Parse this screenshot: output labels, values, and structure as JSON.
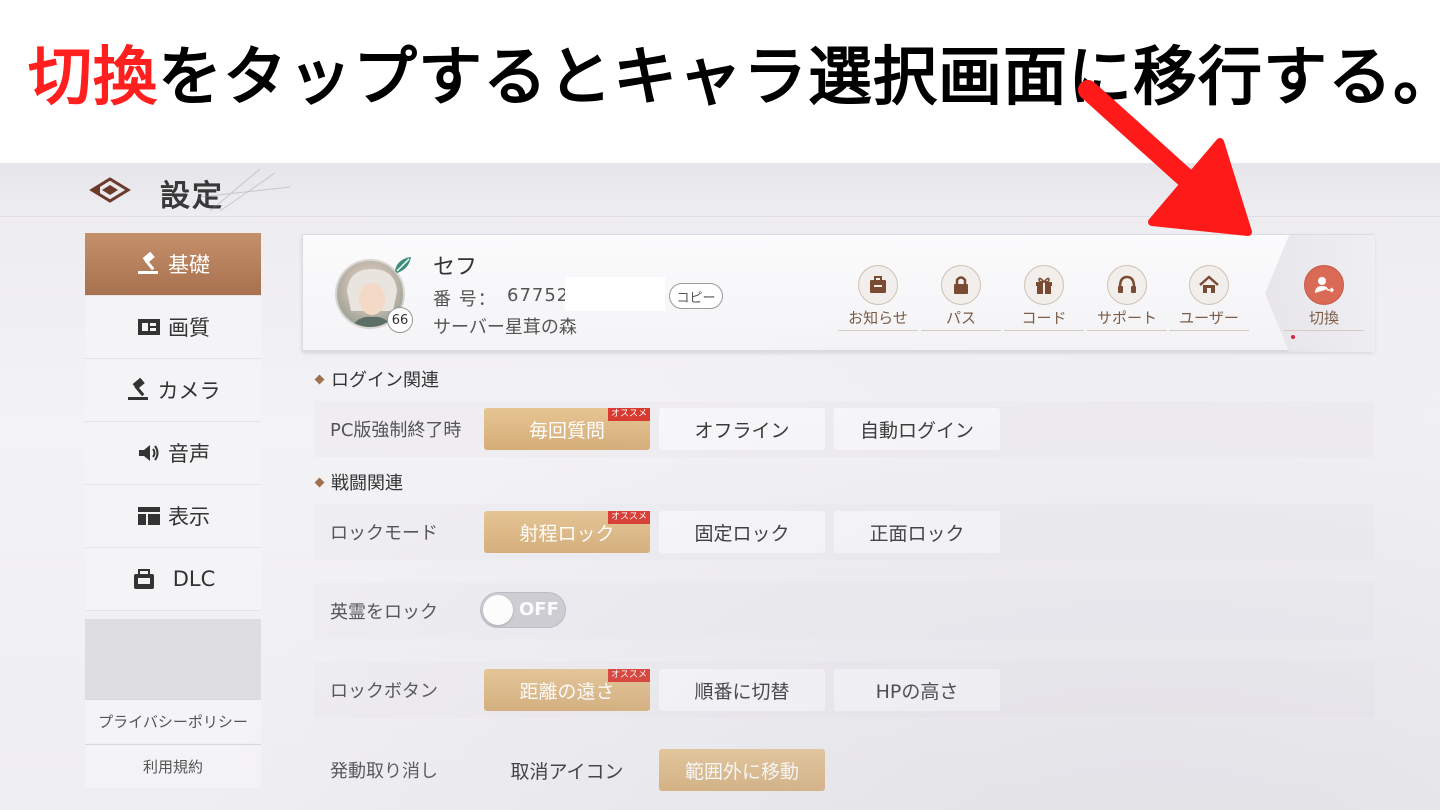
{
  "caption": {
    "highlight": "切換",
    "rest": "をタップするとキャラ選択画面に移行する。"
  },
  "header": {
    "title": "設定"
  },
  "sidebar": {
    "items": [
      {
        "label": "基礎",
        "icon": "hammer-icon",
        "active": true
      },
      {
        "label": "画質",
        "icon": "display-quality-icon",
        "active": false
      },
      {
        "label": "カメラ",
        "icon": "camera-icon",
        "active": false
      },
      {
        "label": "音声",
        "icon": "speaker-icon",
        "active": false
      },
      {
        "label": "表示",
        "icon": "layout-icon",
        "active": false
      },
      {
        "label": "DLC",
        "icon": "bag-icon",
        "active": false
      }
    ],
    "privacy": "プライバシーポリシー",
    "terms": "利用規約"
  },
  "profile": {
    "name": "セフ",
    "id_label": "番 号：",
    "id": "67752",
    "copy": "コピー",
    "server": "サーバー星茸の森",
    "level": "66"
  },
  "quick_actions": [
    {
      "label": "お知らせ",
      "icon": "notice-icon"
    },
    {
      "label": "パス",
      "icon": "lock-icon"
    },
    {
      "label": "コード",
      "icon": "gift-icon"
    },
    {
      "label": "サポート",
      "icon": "headset-icon"
    },
    {
      "label": "ユーザー",
      "icon": "home-icon"
    }
  ],
  "switch_action": {
    "label": "切換",
    "icon": "switch-user-icon"
  },
  "sections": {
    "login": "ログイン関連",
    "battle": "戦闘関連"
  },
  "settings": {
    "pc_exit": {
      "label": "PC版強制終了時",
      "options": [
        "毎回質問",
        "オフライン",
        "自動ログイン"
      ],
      "selected": 0,
      "recommended": 0
    },
    "lock_mode": {
      "label": "ロックモード",
      "options": [
        "射程ロック",
        "固定ロック",
        "正面ロック"
      ],
      "selected": 0,
      "recommended": 0
    },
    "hero_lock": {
      "label": "英霊をロック",
      "state": "OFF"
    },
    "lock_button": {
      "label": "ロックボタン",
      "options": [
        "距離の遠さ",
        "順番に切替",
        "HPの高さ"
      ],
      "selected": 0,
      "recommended": 0
    },
    "cancel_cast": {
      "label": "発動取り消し",
      "options": [
        "取消アイコン",
        "範囲外に移動"
      ],
      "selected": 1
    }
  },
  "recommended_badge": "オススメ",
  "colors": {
    "accent_brown": "#a8714f",
    "selected_gold": "#d5ad77",
    "highlight_red": "#ff1f1f",
    "switch_red": "#d96a55"
  }
}
